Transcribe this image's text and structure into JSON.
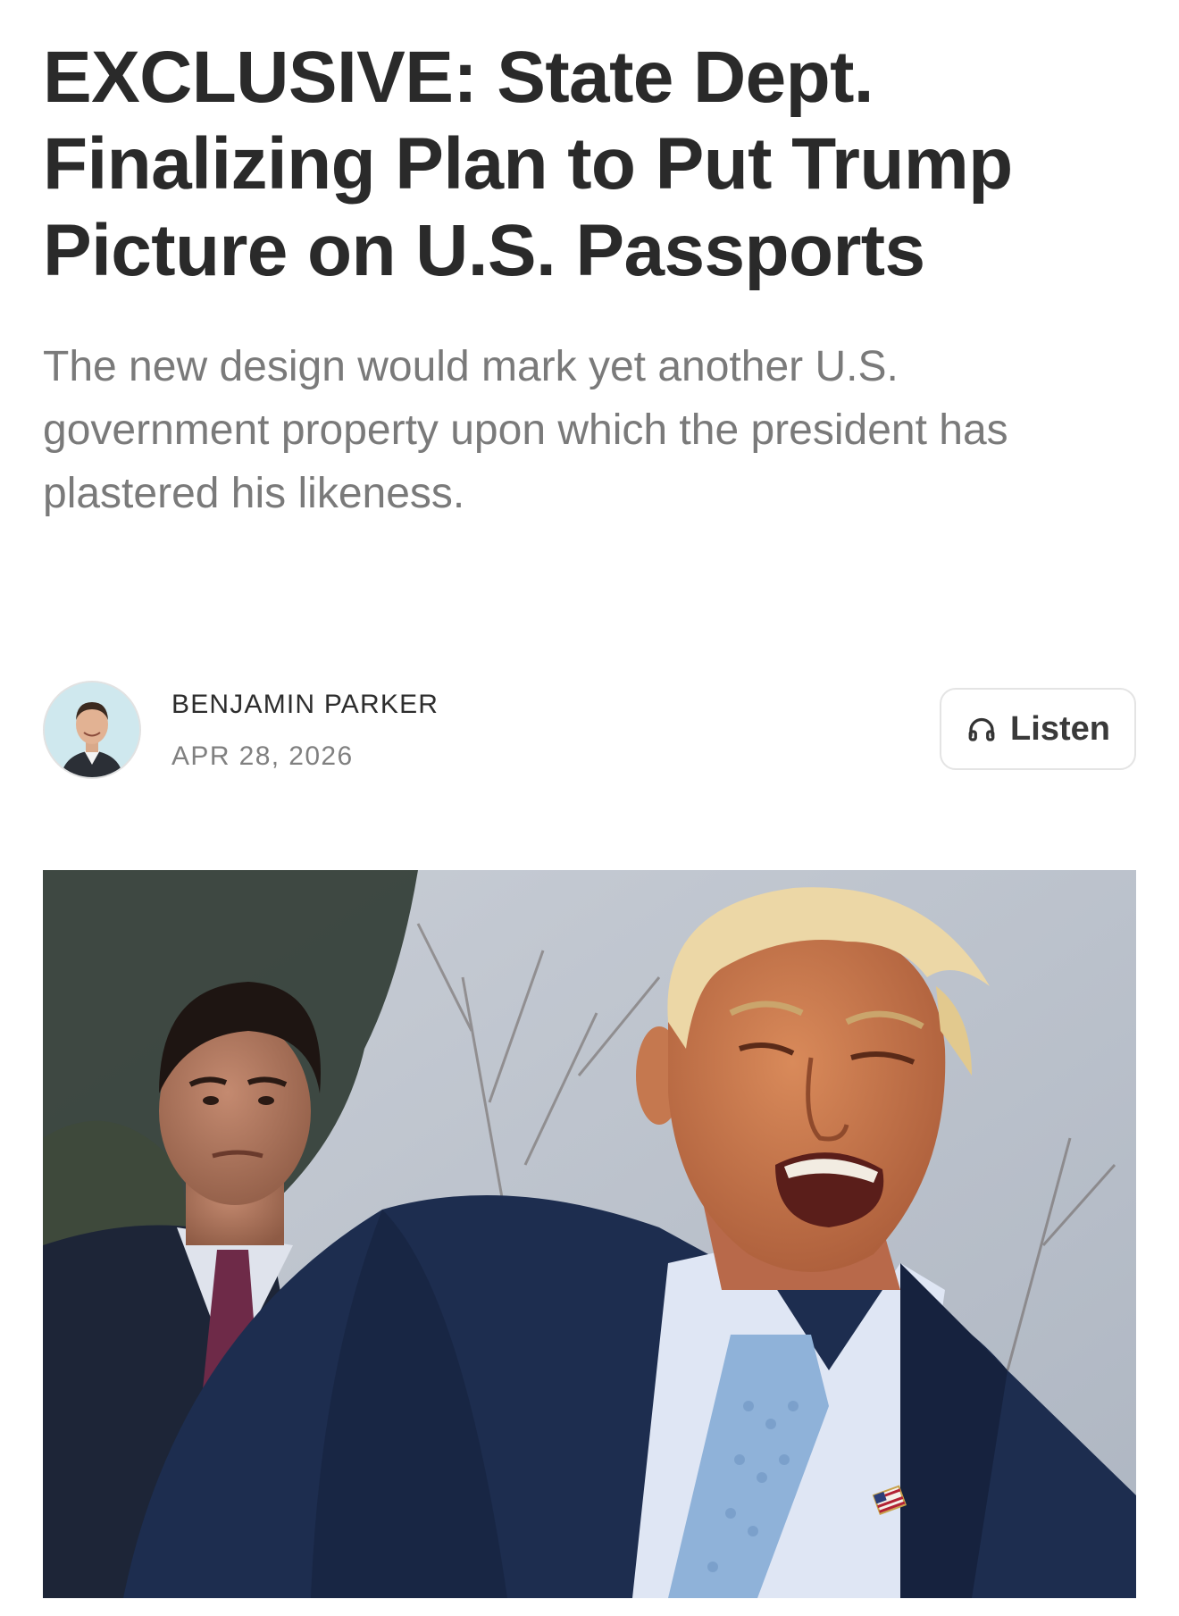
{
  "article": {
    "headline": "EXCLUSIVE: State Dept. Finalizing Plan to Put Trump Picture on U.S. Passports",
    "subtitle": "The new design would mark yet another U.S. government property upon which the president has plastered his likeness.",
    "author": "BENJAMIN PARKER",
    "date": "APR 28, 2026",
    "listen_label": "Listen"
  },
  "icons": {
    "listen": "headphones-icon"
  },
  "colors": {
    "headline": "#2a2a2a",
    "subtitle": "#7a7a7a",
    "suit": "#1d2d4f",
    "tie_left": "#6e2a48",
    "tie_right": "#8fb2d9"
  }
}
